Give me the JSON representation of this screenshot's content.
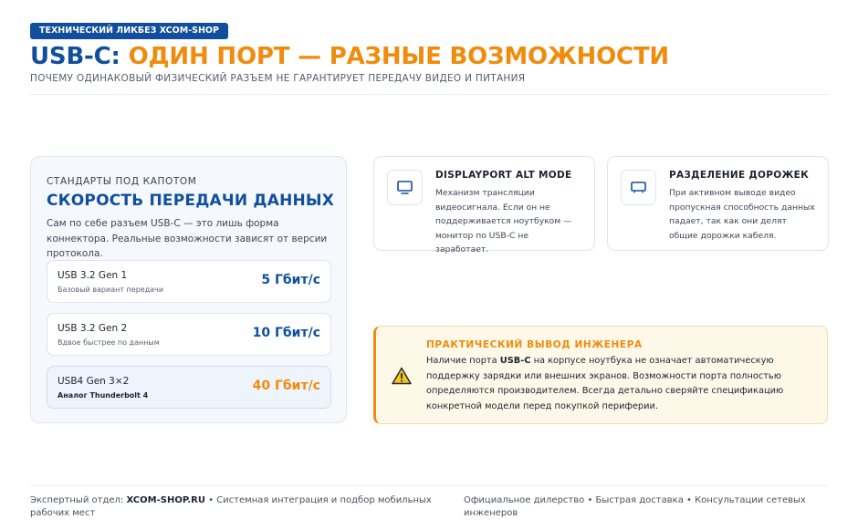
{
  "header": {
    "badge": "ТЕХНИЧЕСКИЙ ЛИКБЕЗ XCOM-SHOP",
    "title_part1": "USB-C: ",
    "title_part2": "ОДИН ПОРТ — РАЗНЫЕ ВОЗМОЖНОСТИ",
    "subtitle": "ПОЧЕМУ ОДИНАКОВЫЙ ФИЗИЧЕСКИЙ РАЗЪЕМ НЕ ГАРАНТИРУЕТ ПЕРЕДАЧУ ВИДЕО И ПИТАНИЯ"
  },
  "standards": {
    "eyebrow": "СТАНДАРТЫ ПОД КАПОТОМ",
    "title": "СКОРОСТЬ ПЕРЕДАЧИ ДАННЫХ",
    "description": "Сам по себе разъем USB-C — это лишь форма коннектора. Реальные возможности зависят от версии протокола.",
    "rows": [
      {
        "name": "USB 3.2 Gen 1",
        "subtitle": "Базовый вариант передачи",
        "value": "5 Гбит/с"
      },
      {
        "name": "USB 3.2 Gen 2",
        "subtitle": "Вдвое быстрее по данным",
        "value": "10 Гбит/с"
      },
      {
        "name": "USB4 Gen 3×2",
        "subtitle": "Аналог Thunderbolt 4",
        "value": "40 Гбит/с"
      }
    ]
  },
  "cards": [
    {
      "icon": "monitor-icon",
      "title": "DISPLAYPORT ALT MODE",
      "text": "Механизм трансляции видеосигнала. Если он не поддерживается ноутбуком — монитор по USB-C не заработает."
    },
    {
      "icon": "monitor-icon",
      "title": "РАЗДЕЛЕНИЕ ДОРОЖЕК",
      "text": "При активном выводе видео пропускная способность данных падает, так как они делят общие дорожки кабеля."
    }
  ],
  "conclusion": {
    "icon": "warning-icon",
    "title": "ПРАКТИЧЕСКИЙ ВЫВОД ИНЖЕНЕРА",
    "text_before": "Наличие порта ",
    "text_bold": "USB-C",
    "text_after": " на корпусе ноутбука не означает автоматическую поддержку зарядки или внешних экранов. Возможности порта полностью определяются производителем. Всегда детально сверяйте спецификацию конкретной модели перед покупкой периферии."
  },
  "footer": {
    "left_prefix": "Экспертный отдел: ",
    "left_brand": "XCOM-SHOP.RU",
    "left_suffix": " • Системная интеграция и подбор мобильных рабочих мест",
    "right": "Официальное дилерство • Быстрая доставка • Консультации сетевых инженеров"
  },
  "colors": {
    "brand_blue": "#114f9e",
    "accent_orange": "#f08c0d",
    "warning_bg": "#fef8e8"
  }
}
